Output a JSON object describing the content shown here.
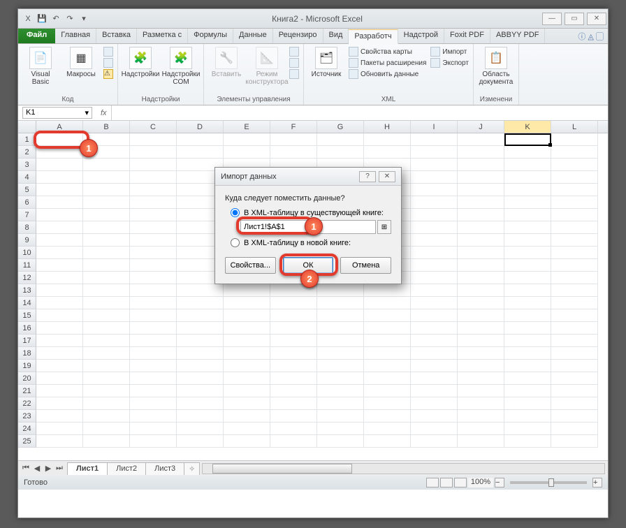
{
  "title": "Книга2 - Microsoft Excel",
  "qat": {
    "excel": "X",
    "save": "💾",
    "undo": "↶",
    "redo": "↷",
    "more": "▾"
  },
  "winctrl": {
    "min": "—",
    "max": "▭",
    "close": "✕"
  },
  "tabs": {
    "file": "Файл",
    "items": [
      "Главная",
      "Вставка",
      "Разметка с",
      "Формулы",
      "Данные",
      "Рецензиро",
      "Вид",
      "Разработч",
      "Надстрой",
      "Foxit PDF",
      "ABBYY PDF"
    ],
    "active": 7
  },
  "ribbon": {
    "g1": {
      "vb": "Visual Basic",
      "macros": "Макросы",
      "label": "Код"
    },
    "g2": {
      "addins": "Надстройки",
      "com": "Надстройки COM",
      "label": "Надстройки"
    },
    "g3": {
      "insert": "Вставить",
      "design": "Режим конструктора",
      "label": "Элементы управления"
    },
    "g4": {
      "source": "Источник",
      "props": "Свойства карты",
      "packs": "Пакеты расширения",
      "refresh": "Обновить данные",
      "import": "Импорт",
      "export": "Экспорт",
      "label": "XML"
    },
    "g5": {
      "panel": "Область документа",
      "label": "Изменени"
    }
  },
  "namebox": "K1",
  "cols": [
    "A",
    "B",
    "C",
    "D",
    "E",
    "F",
    "G",
    "H",
    "I",
    "J",
    "K",
    "L"
  ],
  "rowcount": 25,
  "sheets": {
    "items": [
      "Лист1",
      "Лист2",
      "Лист3"
    ],
    "active": 0
  },
  "status": {
    "ready": "Готово",
    "zoom": "100%"
  },
  "dialog": {
    "title": "Импорт данных",
    "question": "Куда следует поместить данные?",
    "opt1": "В XML-таблицу в существующей книге:",
    "ref": "Лист1!$A$1",
    "opt2": "В XML-таблицу в новой книге:",
    "props": "Свойства...",
    "ok": "ОК",
    "cancel": "Отмена"
  }
}
